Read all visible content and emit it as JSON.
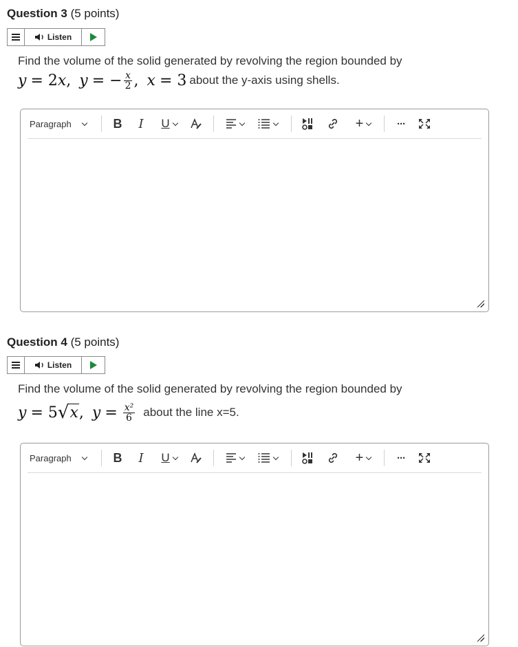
{
  "questions": [
    {
      "title": "Question 3",
      "points": "(5 points)",
      "listen_label": "Listen",
      "prompt": "Find the volume of the solid generated by revolving the region bounded by",
      "math": {
        "y1": "y",
        "eq1": "= 2",
        "x1": "x",
        "sep1": ",",
        "y2": "y",
        "eq2": "= −",
        "frac_num": "x",
        "frac_den": "2",
        "sep2": ",",
        "x3": "x",
        "eq3": "= 3",
        "tail": "about the y-axis using shells."
      },
      "editor": {
        "format": "Paragraph"
      }
    },
    {
      "title": "Question 4",
      "points": "(5 points)",
      "listen_label": "Listen",
      "prompt": "Find the volume of the solid generated by revolving the region bounded by",
      "math": {
        "y1": "y",
        "eq1": "= 5",
        "sqrt_arg": "x",
        "sep1": ",",
        "y2": "y",
        "eq2": "=",
        "frac_num": "x²",
        "frac_den": "6",
        "tail": "about the line x=5."
      },
      "editor": {
        "format": "Paragraph"
      }
    }
  ],
  "toolbar_icons": [
    "bold-icon",
    "italic-icon",
    "underline-icon",
    "text-color-icon",
    "align-icon",
    "list-icon",
    "insert-media-icon",
    "link-icon",
    "add-icon",
    "more-icon",
    "fullscreen-icon"
  ],
  "toolbar_labels": {
    "bold": "B",
    "italic": "I",
    "underline": "U",
    "plus": "+",
    "more": "···"
  }
}
